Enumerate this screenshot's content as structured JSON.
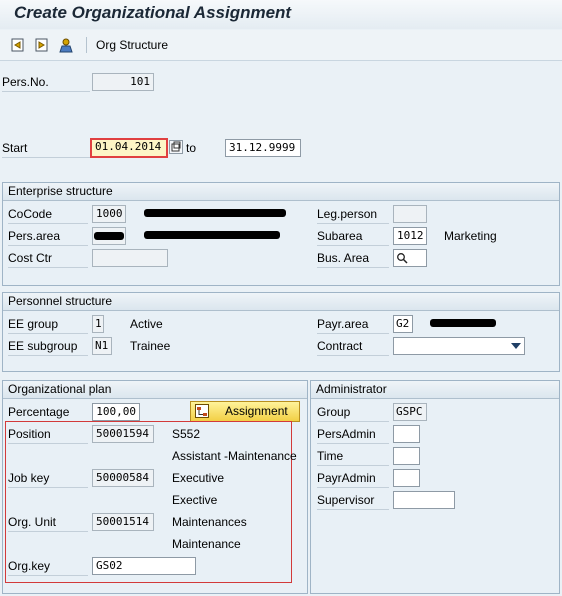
{
  "window": {
    "title": "Create Organizational Assignment"
  },
  "toolbar": {
    "org_structure": "Org Structure"
  },
  "header": {
    "pers_no_label": "Pers.No.",
    "pers_no_value": "101",
    "start_label": "Start",
    "start_value": "01.04.2014",
    "to_label": "to",
    "end_value": "31.12.9999"
  },
  "enterprise": {
    "title": "Enterprise structure",
    "cocode_label": "CoCode",
    "cocode_value": "1000",
    "pers_area_label": "Pers.area",
    "cost_ctr_label": "Cost Ctr",
    "leg_person_label": "Leg.person",
    "subarea_label": "Subarea",
    "subarea_value": "1012",
    "subarea_text": "Marketing",
    "bus_area_label": "Bus. Area"
  },
  "personnel": {
    "title": "Personnel structure",
    "ee_group_label": "EE group",
    "ee_group_value": "1",
    "ee_group_text": "Active",
    "ee_subgroup_label": "EE subgroup",
    "ee_subgroup_value": "N1",
    "ee_subgroup_text": "Trainee",
    "payr_area_label": "Payr.area",
    "payr_area_value": "G2",
    "contract_label": "Contract"
  },
  "orgplan": {
    "title": "Organizational plan",
    "percentage_label": "Percentage",
    "percentage_value": "100,00",
    "assignment_button": "Assignment",
    "position_label": "Position",
    "position_value": "50001594",
    "position_text1": "S552",
    "position_text2": "Assistant -Maintenance",
    "job_key_label": "Job key",
    "job_key_value": "50000584",
    "job_text1": "Executive",
    "job_text2": "Exective",
    "org_unit_label": "Org. Unit",
    "org_unit_value": "50001514",
    "org_unit_text1": "Maintenances",
    "org_unit_text2": "Maintenance",
    "org_key_label": "Org.key",
    "org_key_value": "GS02"
  },
  "administrator": {
    "title": "Administrator",
    "group_label": "Group",
    "group_value": "GSPC",
    "pers_admin_label": "PersAdmin",
    "time_label": "Time",
    "payr_admin_label": "PayrAdmin",
    "supervisor_label": "Supervisor"
  },
  "colors": {
    "highlight_box": "#d23a3a",
    "required_field": "#fdf5c6",
    "button": "#f2cf45"
  }
}
